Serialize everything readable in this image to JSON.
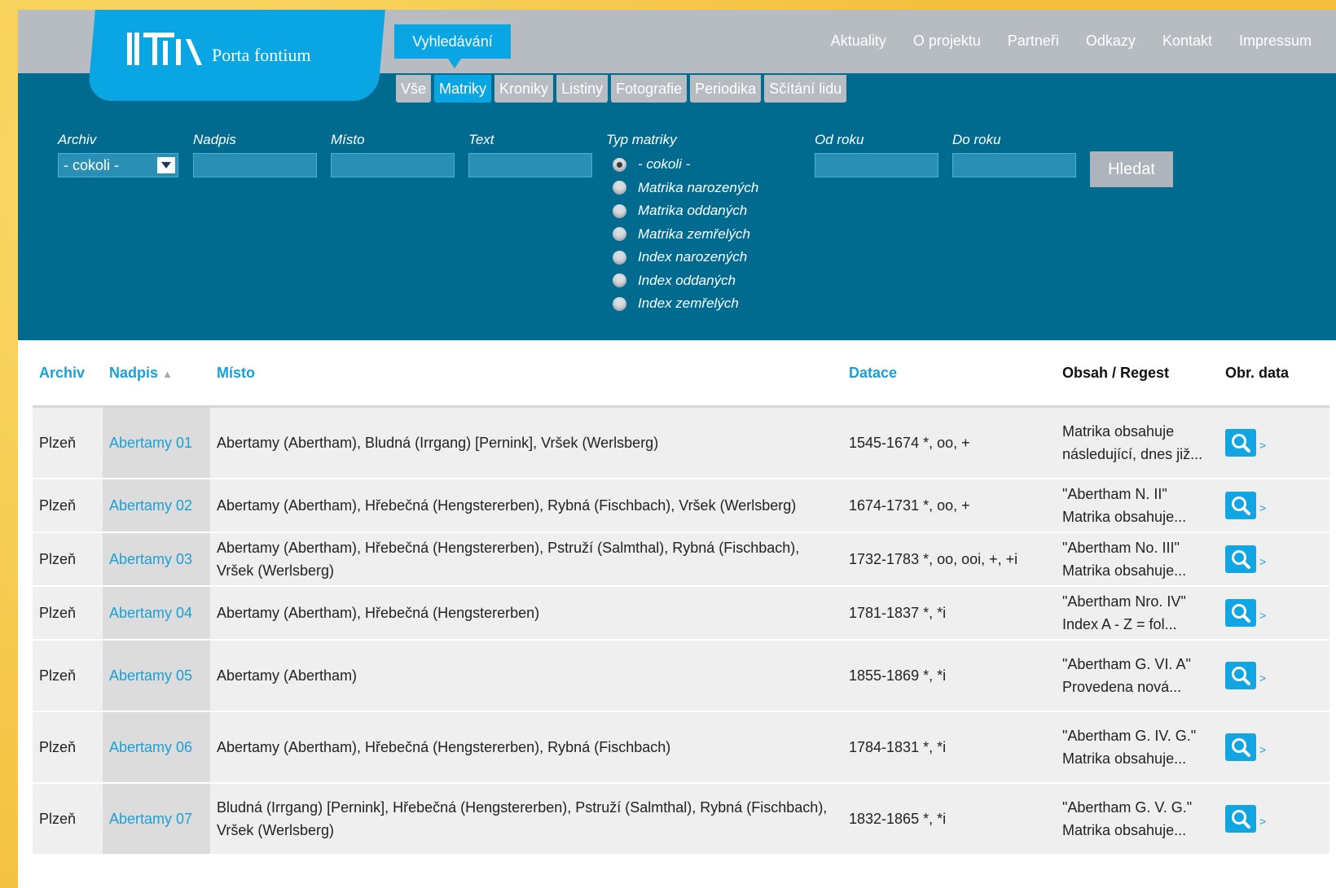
{
  "logo": {
    "text": "Porta fontium"
  },
  "nav": {
    "search": "Vyhledávání",
    "links": [
      "Aktuality",
      "O projektu",
      "Partneři",
      "Odkazy",
      "Kontakt",
      "Impressum"
    ]
  },
  "subtabs": {
    "items": [
      "Vše",
      "Matriky",
      "Kroniky",
      "Listiny",
      "Fotografie",
      "Periodika",
      "Sčítání lidu"
    ],
    "active": "Matriky"
  },
  "filters": {
    "archiv_label": "Archiv",
    "archiv_value": "- cokoli -",
    "nadpis_label": "Nadpis",
    "misto_label": "Místo",
    "text_label": "Text",
    "typ_label": "Typ matriky",
    "od_label": "Od roku",
    "do_label": "Do roku",
    "search_button": "Hledat",
    "typ_options": [
      "- cokoli -",
      "Matrika narozených",
      "Matrika oddaných",
      "Matrika zemřelých",
      "Index narozených",
      "Index oddaných",
      "Index zemřelých"
    ]
  },
  "table": {
    "headers": {
      "archiv": "Archiv",
      "nadpis": "Nadpis",
      "misto": "Místo",
      "datace": "Datace",
      "obsah": "Obsah / Regest",
      "obr": "Obr. data"
    },
    "rows": [
      {
        "archiv": "Plzeň",
        "nadpis": "Abertamy 01",
        "misto": "Abertamy (Abertham), Bludná (Irrgang) [Pernink], Vršek (Werlsberg)",
        "datace": "1545-1674 *, oo, +",
        "obsah": "Matrika obsahuje následující, dnes již..."
      },
      {
        "archiv": "Plzeň",
        "nadpis": "Abertamy 02",
        "misto": "Abertamy (Abertham), Hřebečná (Hengstererben), Rybná (Fischbach), Vršek (Werlsberg)",
        "datace": "1674-1731 *, oo, +",
        "obsah": "\"Abertham N. II\" Matrika obsahuje..."
      },
      {
        "archiv": "Plzeň",
        "nadpis": "Abertamy 03",
        "misto": "Abertamy (Abertham), Hřebečná (Hengstererben), Pstruží (Salmthal), Rybná (Fischbach), Vršek (Werlsberg)",
        "datace": "1732-1783 *, oo, ooi, +, +i",
        "obsah": "\"Abertham No. III\" Matrika obsahuje..."
      },
      {
        "archiv": "Plzeň",
        "nadpis": "Abertamy 04",
        "misto": "Abertamy (Abertham), Hřebečná (Hengstererben)",
        "datace": "1781-1837 *, *i",
        "obsah": "\"Abertham Nro. IV\" Index A - Z = fol..."
      },
      {
        "archiv": "Plzeň",
        "nadpis": "Abertamy 05",
        "misto": "Abertamy (Abertham)",
        "datace": "1855-1869 *, *i",
        "obsah": "\"Abertham G. VI. A\" Provedena nová..."
      },
      {
        "archiv": "Plzeň",
        "nadpis": "Abertamy 06",
        "misto": "Abertamy (Abertham), Hřebečná (Hengstererben), Rybná (Fischbach)",
        "datace": "1784-1831 *, *i",
        "obsah": "\"Abertham G. IV. G.\" Matrika obsahuje..."
      },
      {
        "archiv": "Plzeň",
        "nadpis": "Abertamy 07",
        "misto": "Bludná (Irrgang) [Pernink], Hřebečná (Hengstererben), Pstruží (Salmthal), Rybná (Fischbach), Vršek (Werlsberg)",
        "datace": "1832-1865 *, *i",
        "obsah": "\"Abertham G. V. G.\" Matrika obsahuje..."
      }
    ]
  },
  "icons": {
    "row_action": "magnifier-icon",
    "more": "chevron-right-icon"
  },
  "colors": {
    "accent": "#0aa6e3",
    "band": "#006b8f",
    "link": "#1aa0d8",
    "topbar": "#b7bcc3"
  }
}
